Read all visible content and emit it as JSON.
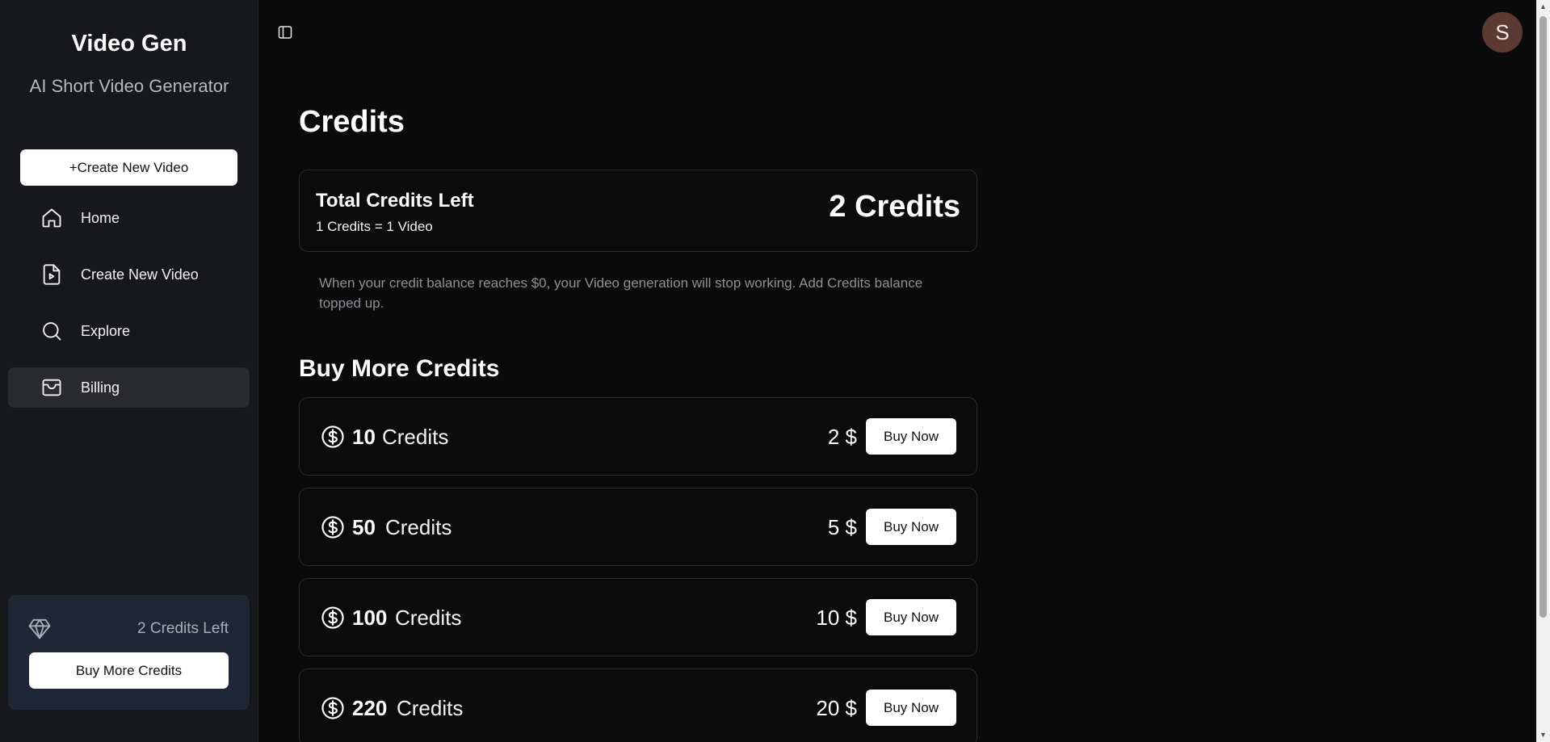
{
  "sidebar": {
    "brand_title": "Video Gen",
    "brand_subtitle": "AI Short Video Generator",
    "create_button": "+Create New Video",
    "nav": [
      {
        "label": "Home",
        "icon": "home-icon"
      },
      {
        "label": "Create New Video",
        "icon": "file-video-icon"
      },
      {
        "label": "Explore",
        "icon": "search-icon"
      },
      {
        "label": "Billing",
        "icon": "wallet-icon",
        "active": true
      }
    ],
    "credits_left_text": "2 Credits Left",
    "buy_more_button": "Buy More Credits"
  },
  "header": {
    "avatar_initial": "S"
  },
  "main": {
    "title": "Credits",
    "summary": {
      "label": "Total Credits Left",
      "rate": "1 Credits = 1 Video",
      "total": "2 Credits"
    },
    "notice": "When your credit balance reaches $0, your Video generation will stop working. Add Credits balance topped up.",
    "section_title": "Buy More Credits",
    "packs": [
      {
        "qty": "10",
        "unit": "Credits",
        "price": "2 $",
        "button": "Buy Now"
      },
      {
        "qty": "50",
        "unit": "Credits",
        "price": "5 $",
        "button": "Buy Now"
      },
      {
        "qty": "100",
        "unit": "Credits",
        "price": "10 $",
        "button": "Buy Now"
      },
      {
        "qty": "220",
        "unit": "Credits",
        "price": "20 $",
        "button": "Buy Now"
      }
    ]
  },
  "colors": {
    "sidebar_bg": "#17181b",
    "main_bg": "#0a0a0a",
    "credits_box_bg": "#1e2735",
    "avatar_bg": "#5b3a32"
  }
}
